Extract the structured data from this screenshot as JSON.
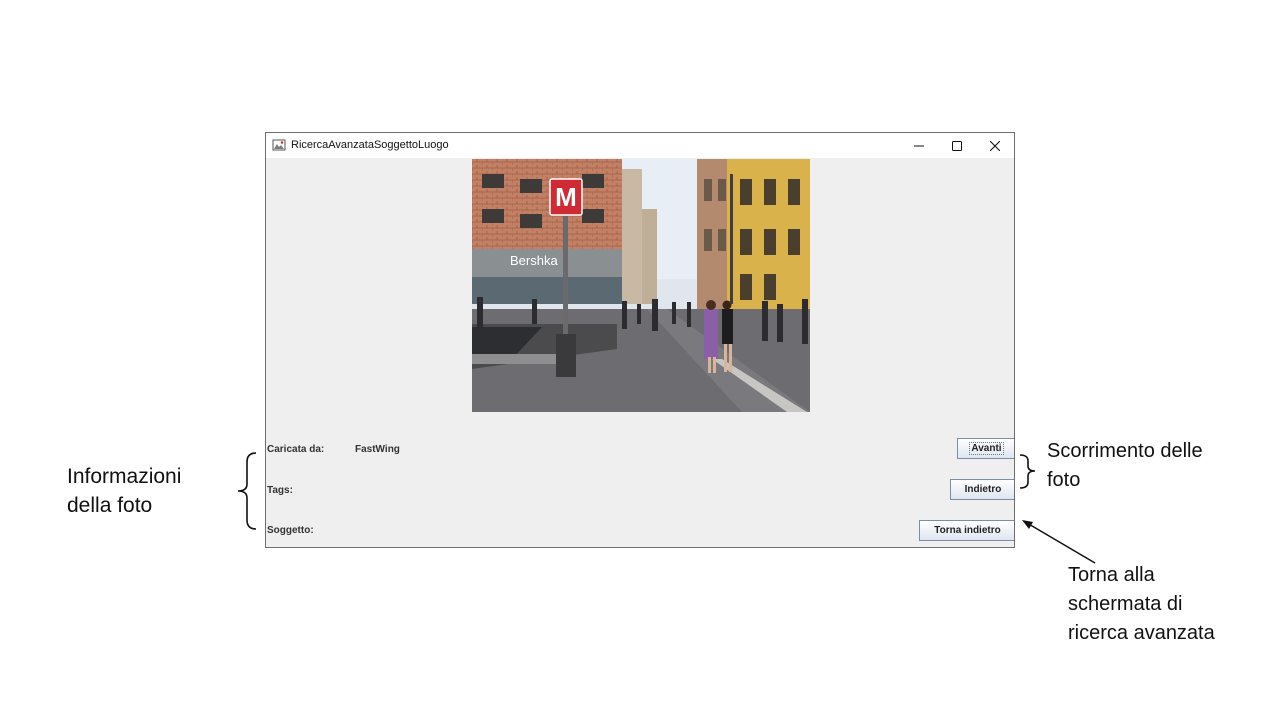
{
  "window": {
    "title": "RicercaAvanzataSoggettoLuogo",
    "controls": {
      "minimize": "minimize-icon",
      "maximize": "maximize-icon",
      "close": "close-icon"
    }
  },
  "photo": {
    "sign_letter": "M",
    "shop_sign": "Bershka"
  },
  "info": {
    "uploaded_by_label": "Caricata da:",
    "uploaded_by_value": "FastWing",
    "tags_label": "Tags:",
    "subject_label": "Soggetto:"
  },
  "buttons": {
    "next": "Avanti",
    "back": "Indietro",
    "return": "Torna indietro"
  },
  "annotations": {
    "info_line1": "Informazioni",
    "info_line2": "della foto",
    "scroll_line1": "Scorrimento delle",
    "scroll_line2": "foto",
    "return_line1": "Torna alla",
    "return_line2": "schermata di",
    "return_line3": "ricerca avanzata"
  },
  "colors": {
    "window_bg": "#efefef",
    "sign_red": "#d02a35",
    "button_border": "#7a8ea6"
  }
}
